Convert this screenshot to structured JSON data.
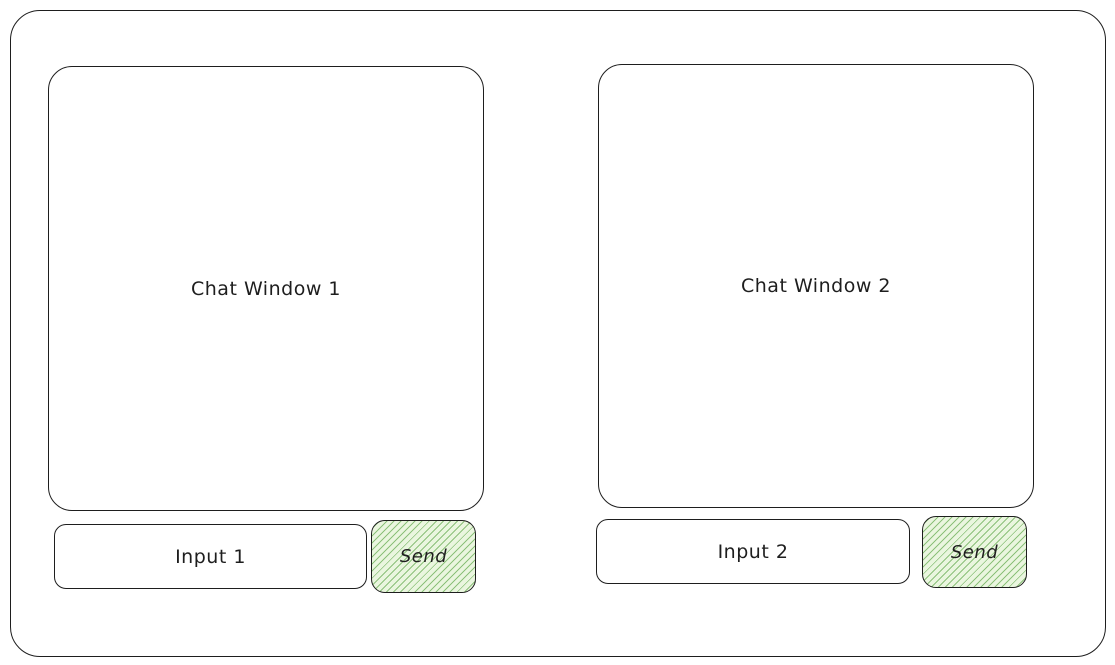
{
  "chat_window_1": {
    "label": "Chat Window 1"
  },
  "chat_window_2": {
    "label": "Chat Window 2"
  },
  "input_1": {
    "label": "Input 1"
  },
  "input_2": {
    "label": "Input 2"
  },
  "send_1": {
    "label": "Send"
  },
  "send_2": {
    "label": "Send"
  },
  "colors": {
    "stroke": "#1e1e1e",
    "send_fill": "#eaf6df",
    "send_hatch": "#409628",
    "background": "#ffffff"
  }
}
